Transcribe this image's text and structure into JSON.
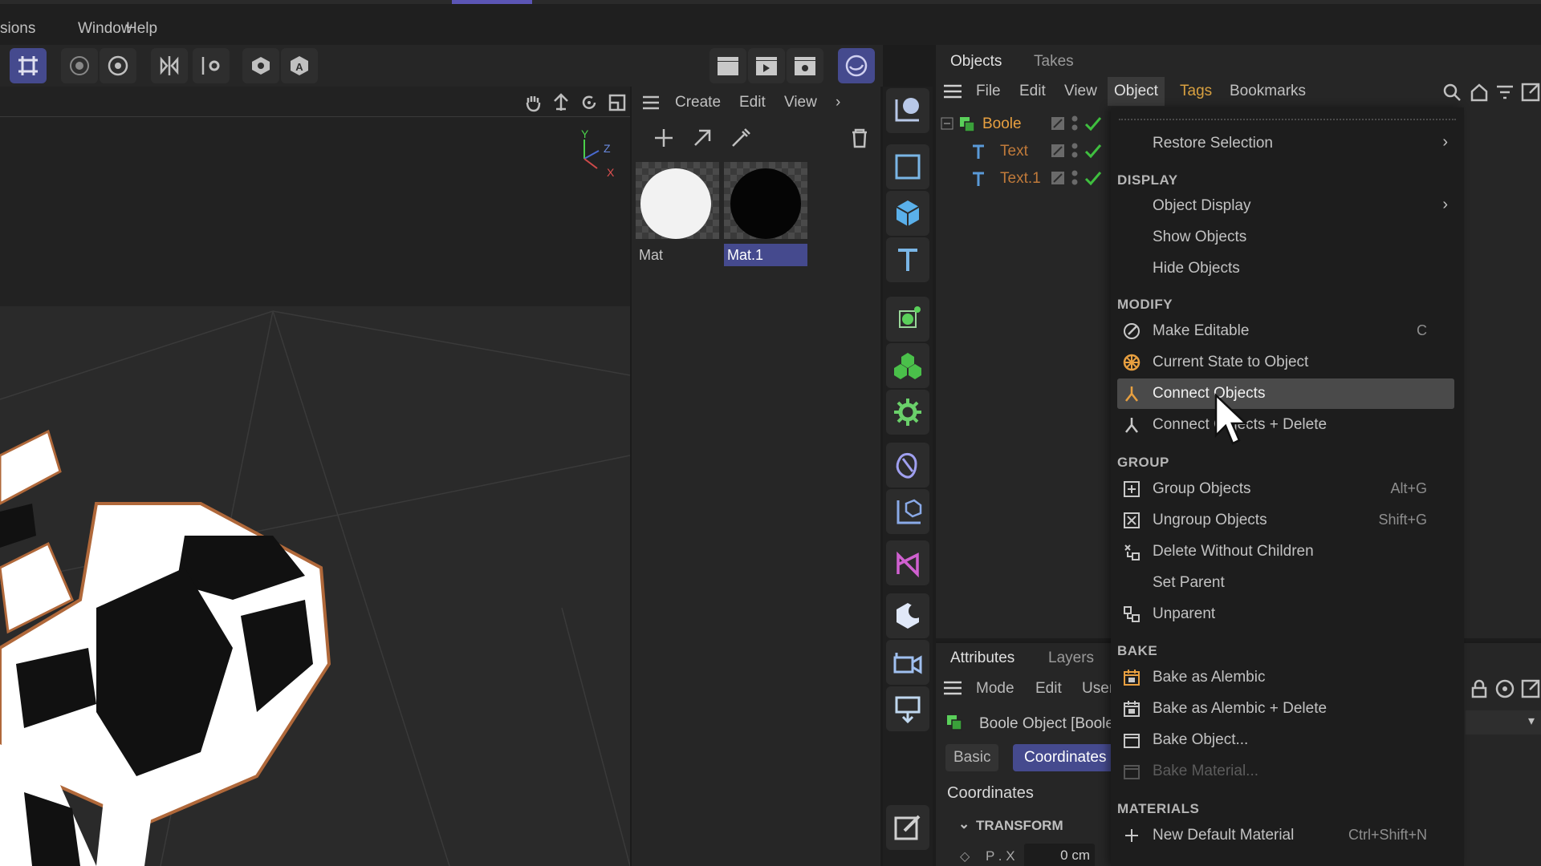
{
  "menubar": {
    "items": [
      "sions",
      "Window",
      "Help"
    ]
  },
  "material_manager": {
    "menu": [
      "Create",
      "Edit",
      "View"
    ],
    "materials": [
      {
        "name": "Mat",
        "selected": false
      },
      {
        "name": "Mat.1",
        "selected": true
      }
    ]
  },
  "objects_panel": {
    "tabs": [
      "Objects",
      "Takes"
    ],
    "menu": [
      "File",
      "Edit",
      "View",
      "Object",
      "Tags",
      "Bookmarks"
    ],
    "active_menu": "Object",
    "objects": [
      {
        "name": "Boole",
        "color": "#e8a040"
      },
      {
        "name": "Text",
        "color": "#c07a3a"
      },
      {
        "name": "Text.1",
        "color": "#c07a3a"
      }
    ]
  },
  "attributes_panel": {
    "tabs": [
      "Attributes",
      "Layers"
    ],
    "menu": [
      "Mode",
      "Edit",
      "User"
    ],
    "object_title": "Boole Object [Boole]",
    "subtabs": [
      "Basic",
      "Coordinates"
    ],
    "active_subtab": "Coordinates",
    "section": "Coordinates",
    "group": "TRANSFORM",
    "field_label": "P . X",
    "field_value": "0 cm"
  },
  "context_menu": {
    "restore_selection": "Restore Selection",
    "sections": {
      "display": "DISPLAY",
      "modify": "MODIFY",
      "group": "GROUP",
      "bake": "BAKE",
      "materials": "MATERIALS"
    },
    "display_items": [
      "Object Display",
      "Show Objects",
      "Hide Objects"
    ],
    "modify_items": [
      {
        "label": "Make Editable",
        "shortcut": "C"
      },
      {
        "label": "Current State to Object",
        "shortcut": ""
      },
      {
        "label": "Connect Objects",
        "shortcut": ""
      },
      {
        "label": "Connect Objects + Delete",
        "shortcut": ""
      }
    ],
    "group_items": [
      {
        "label": "Group Objects",
        "shortcut": "Alt+G"
      },
      {
        "label": "Ungroup Objects",
        "shortcut": "Shift+G"
      },
      {
        "label": "Delete Without Children",
        "shortcut": ""
      },
      {
        "label": "Set Parent",
        "shortcut": ""
      },
      {
        "label": "Unparent",
        "shortcut": ""
      }
    ],
    "bake_items": [
      "Bake as Alembic",
      "Bake as Alembic + Delete",
      "Bake Object...",
      "Bake Material..."
    ],
    "material_items": [
      {
        "label": "New Default Material",
        "shortcut": "Ctrl+Shift+N"
      }
    ],
    "highlighted": "Connect Objects"
  },
  "colors": {
    "accent": "#454a8e",
    "selection": "#4a4a4a",
    "check": "#3fbf3f",
    "orange": "#e8a040"
  },
  "viewport": {
    "axes": [
      "Y",
      "Z",
      "X"
    ]
  }
}
